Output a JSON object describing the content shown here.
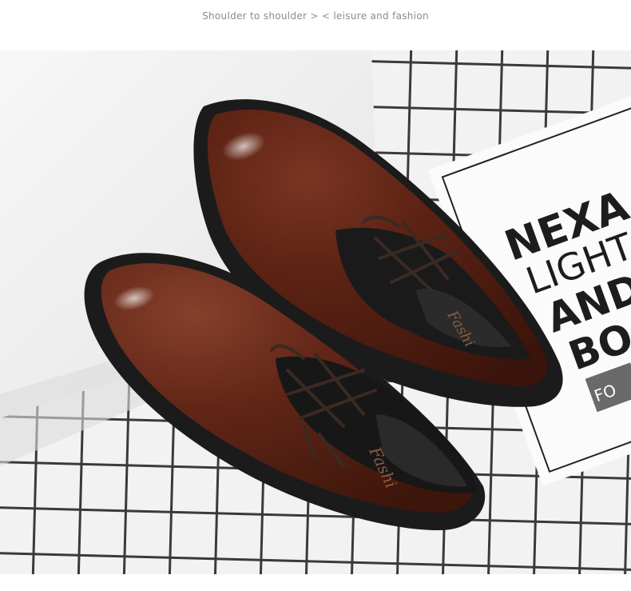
{
  "header": {
    "caption": "Shoulder to shoulder > < leisure and fashion"
  },
  "photo": {
    "subject": "brown leather lace-up shoes",
    "magazine": {
      "line1": "NEXA",
      "line2": "LIGHT",
      "line3": "AND",
      "line4": "BO",
      "badge": "FO"
    },
    "insole_text": "Fashi"
  },
  "colors": {
    "leather": "#5a2114",
    "sole": "#1c1c1c",
    "grid_line": "#3a3a3a",
    "caption": "#8b8b8b"
  }
}
